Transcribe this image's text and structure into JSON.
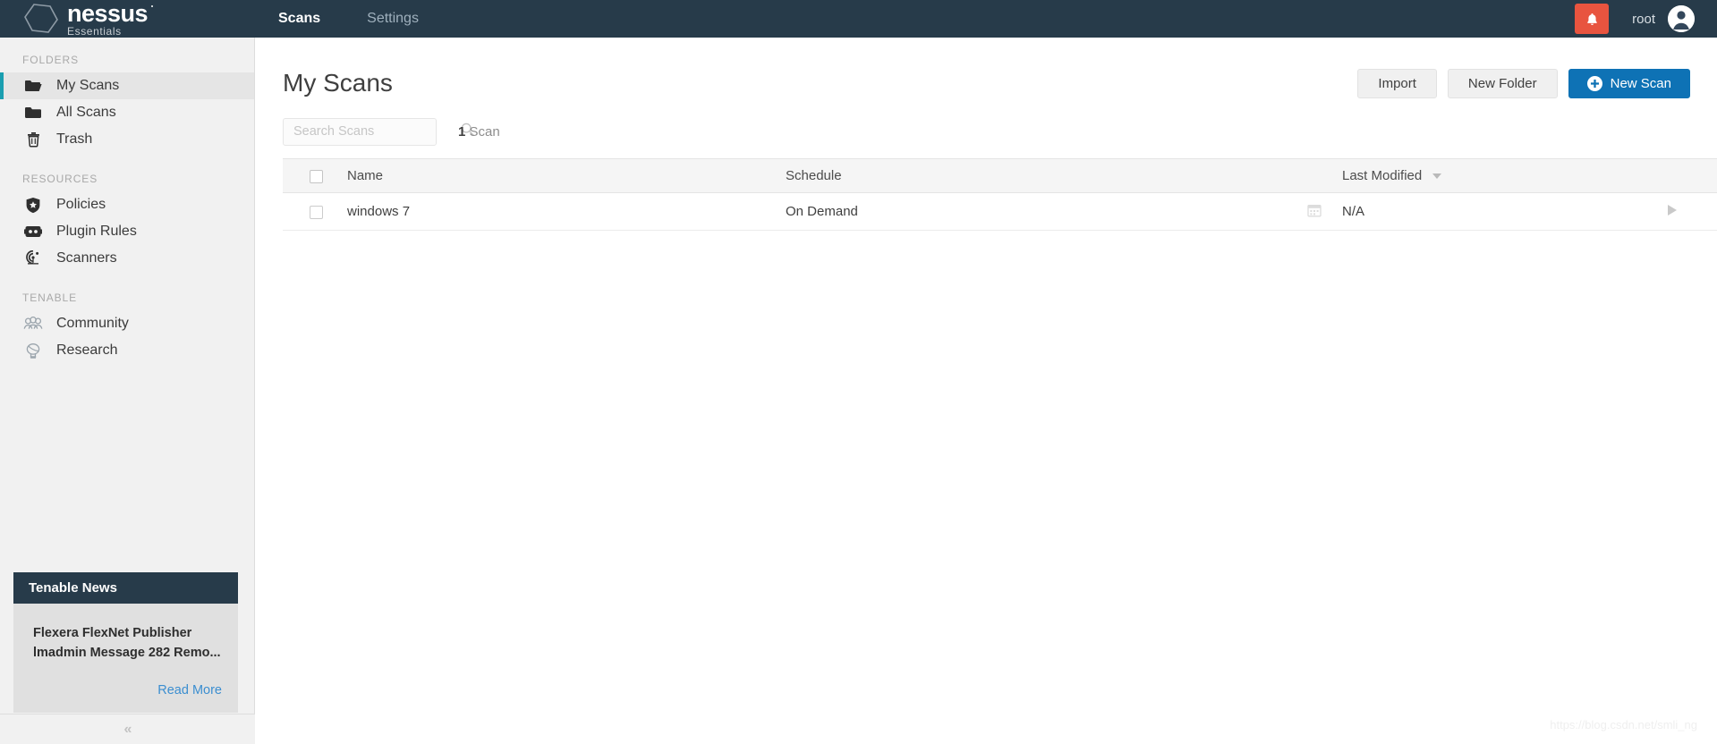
{
  "topbar": {
    "logo_name": "nessus",
    "logo_sub": "Essentials",
    "tabs": [
      {
        "label": "Scans",
        "active": true
      },
      {
        "label": "Settings",
        "active": false
      }
    ],
    "notification_icon": "bell-icon",
    "user_name": "root",
    "avatar_icon": "user-avatar-icon"
  },
  "sidebar": {
    "folders_label": "FOLDERS",
    "folders": [
      {
        "label": "My Scans",
        "icon": "folder-open-icon",
        "active": true
      },
      {
        "label": "All Scans",
        "icon": "folder-icon",
        "active": false
      },
      {
        "label": "Trash",
        "icon": "trash-icon",
        "active": false
      }
    ],
    "resources_label": "RESOURCES",
    "resources": [
      {
        "label": "Policies",
        "icon": "shield-star-icon"
      },
      {
        "label": "Plugin Rules",
        "icon": "plugin-icon"
      },
      {
        "label": "Scanners",
        "icon": "radar-icon"
      }
    ],
    "tenable_label": "TENABLE",
    "tenable": [
      {
        "label": "Community",
        "icon": "people-icon"
      },
      {
        "label": "Research",
        "icon": "research-icon"
      }
    ],
    "news": {
      "header": "Tenable News",
      "title": "Flexera FlexNet Publisher lmadmin Message 282 Remo...",
      "read_more": "Read More"
    },
    "collapse_label": "«"
  },
  "main": {
    "page_title": "My Scans",
    "buttons": {
      "import": "Import",
      "new_folder": "New Folder",
      "new_scan": "New Scan"
    },
    "search": {
      "placeholder": "Search Scans",
      "value": "",
      "icon": "search-icon"
    },
    "scan_count_number": "1",
    "scan_count_label": "Scan",
    "table": {
      "columns": [
        "Name",
        "Schedule",
        "Last Modified"
      ],
      "sort_column": "Last Modified",
      "sort_direction": "desc",
      "rows": [
        {
          "name": "windows 7",
          "schedule": "On Demand",
          "last_modified": "N/A",
          "calendar_icon": "calendar-icon",
          "launch_icon": "play-icon",
          "delete_icon": "close-icon"
        }
      ]
    }
  },
  "watermark": "https://blog.csdn.net/smli_ng",
  "colors": {
    "navy": "#273b4a",
    "accent_teal": "#1a9eb0",
    "primary_blue": "#0e72b5",
    "alert_red": "#e8543f",
    "link_blue": "#3b8ed0"
  }
}
